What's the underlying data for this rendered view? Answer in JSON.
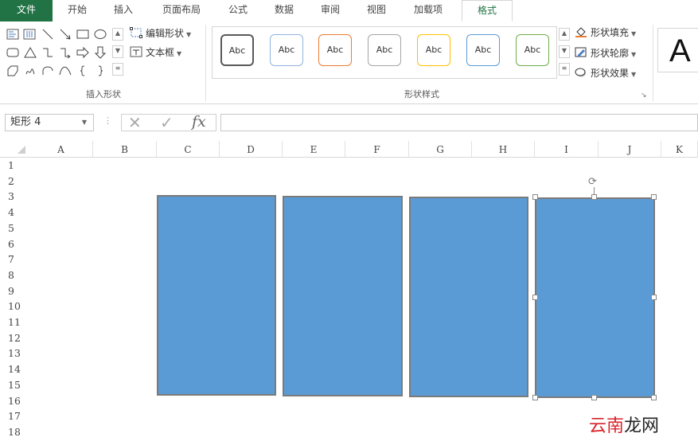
{
  "tabs": [
    "文件",
    "开始",
    "插入",
    "页面布局",
    "公式",
    "数据",
    "审阅",
    "视图",
    "加载项",
    "格式"
  ],
  "ribbon": {
    "insert_shapes": {
      "edit_shape": "编辑形状",
      "text_box": "文本框",
      "label": "插入形状"
    },
    "shape_styles": {
      "presets": [
        {
          "text": "Abc",
          "color": "#595959"
        },
        {
          "text": "Abc",
          "color": "#8fb4de"
        },
        {
          "text": "Abc",
          "color": "#ed7d31"
        },
        {
          "text": "Abc",
          "color": "#a5a5a5"
        },
        {
          "text": "Abc",
          "color": "#ffc000"
        },
        {
          "text": "Abc",
          "color": "#5b9bd5"
        },
        {
          "text": "Abc",
          "color": "#70ad47"
        }
      ],
      "fill": "形状填充",
      "outline": "形状轮廓",
      "effects": "形状效果",
      "label": "形状样式"
    },
    "wordart_letter": "A"
  },
  "formula_bar": {
    "name_box": "矩形 4",
    "fx": "fx",
    "value": ""
  },
  "columns": [
    "A",
    "B",
    "C",
    "D",
    "E",
    "F",
    "G",
    "H",
    "I",
    "J",
    "K"
  ],
  "rows": [
    "1",
    "2",
    "3",
    "4",
    "5",
    "6",
    "7",
    "8",
    "9",
    "10",
    "11",
    "12",
    "13",
    "14",
    "15",
    "16",
    "17",
    "18"
  ],
  "shape_fill_color": "#5b9bd5",
  "accent_color": "#217346",
  "watermark": {
    "part1": "云南",
    "part2": "龙网"
  }
}
